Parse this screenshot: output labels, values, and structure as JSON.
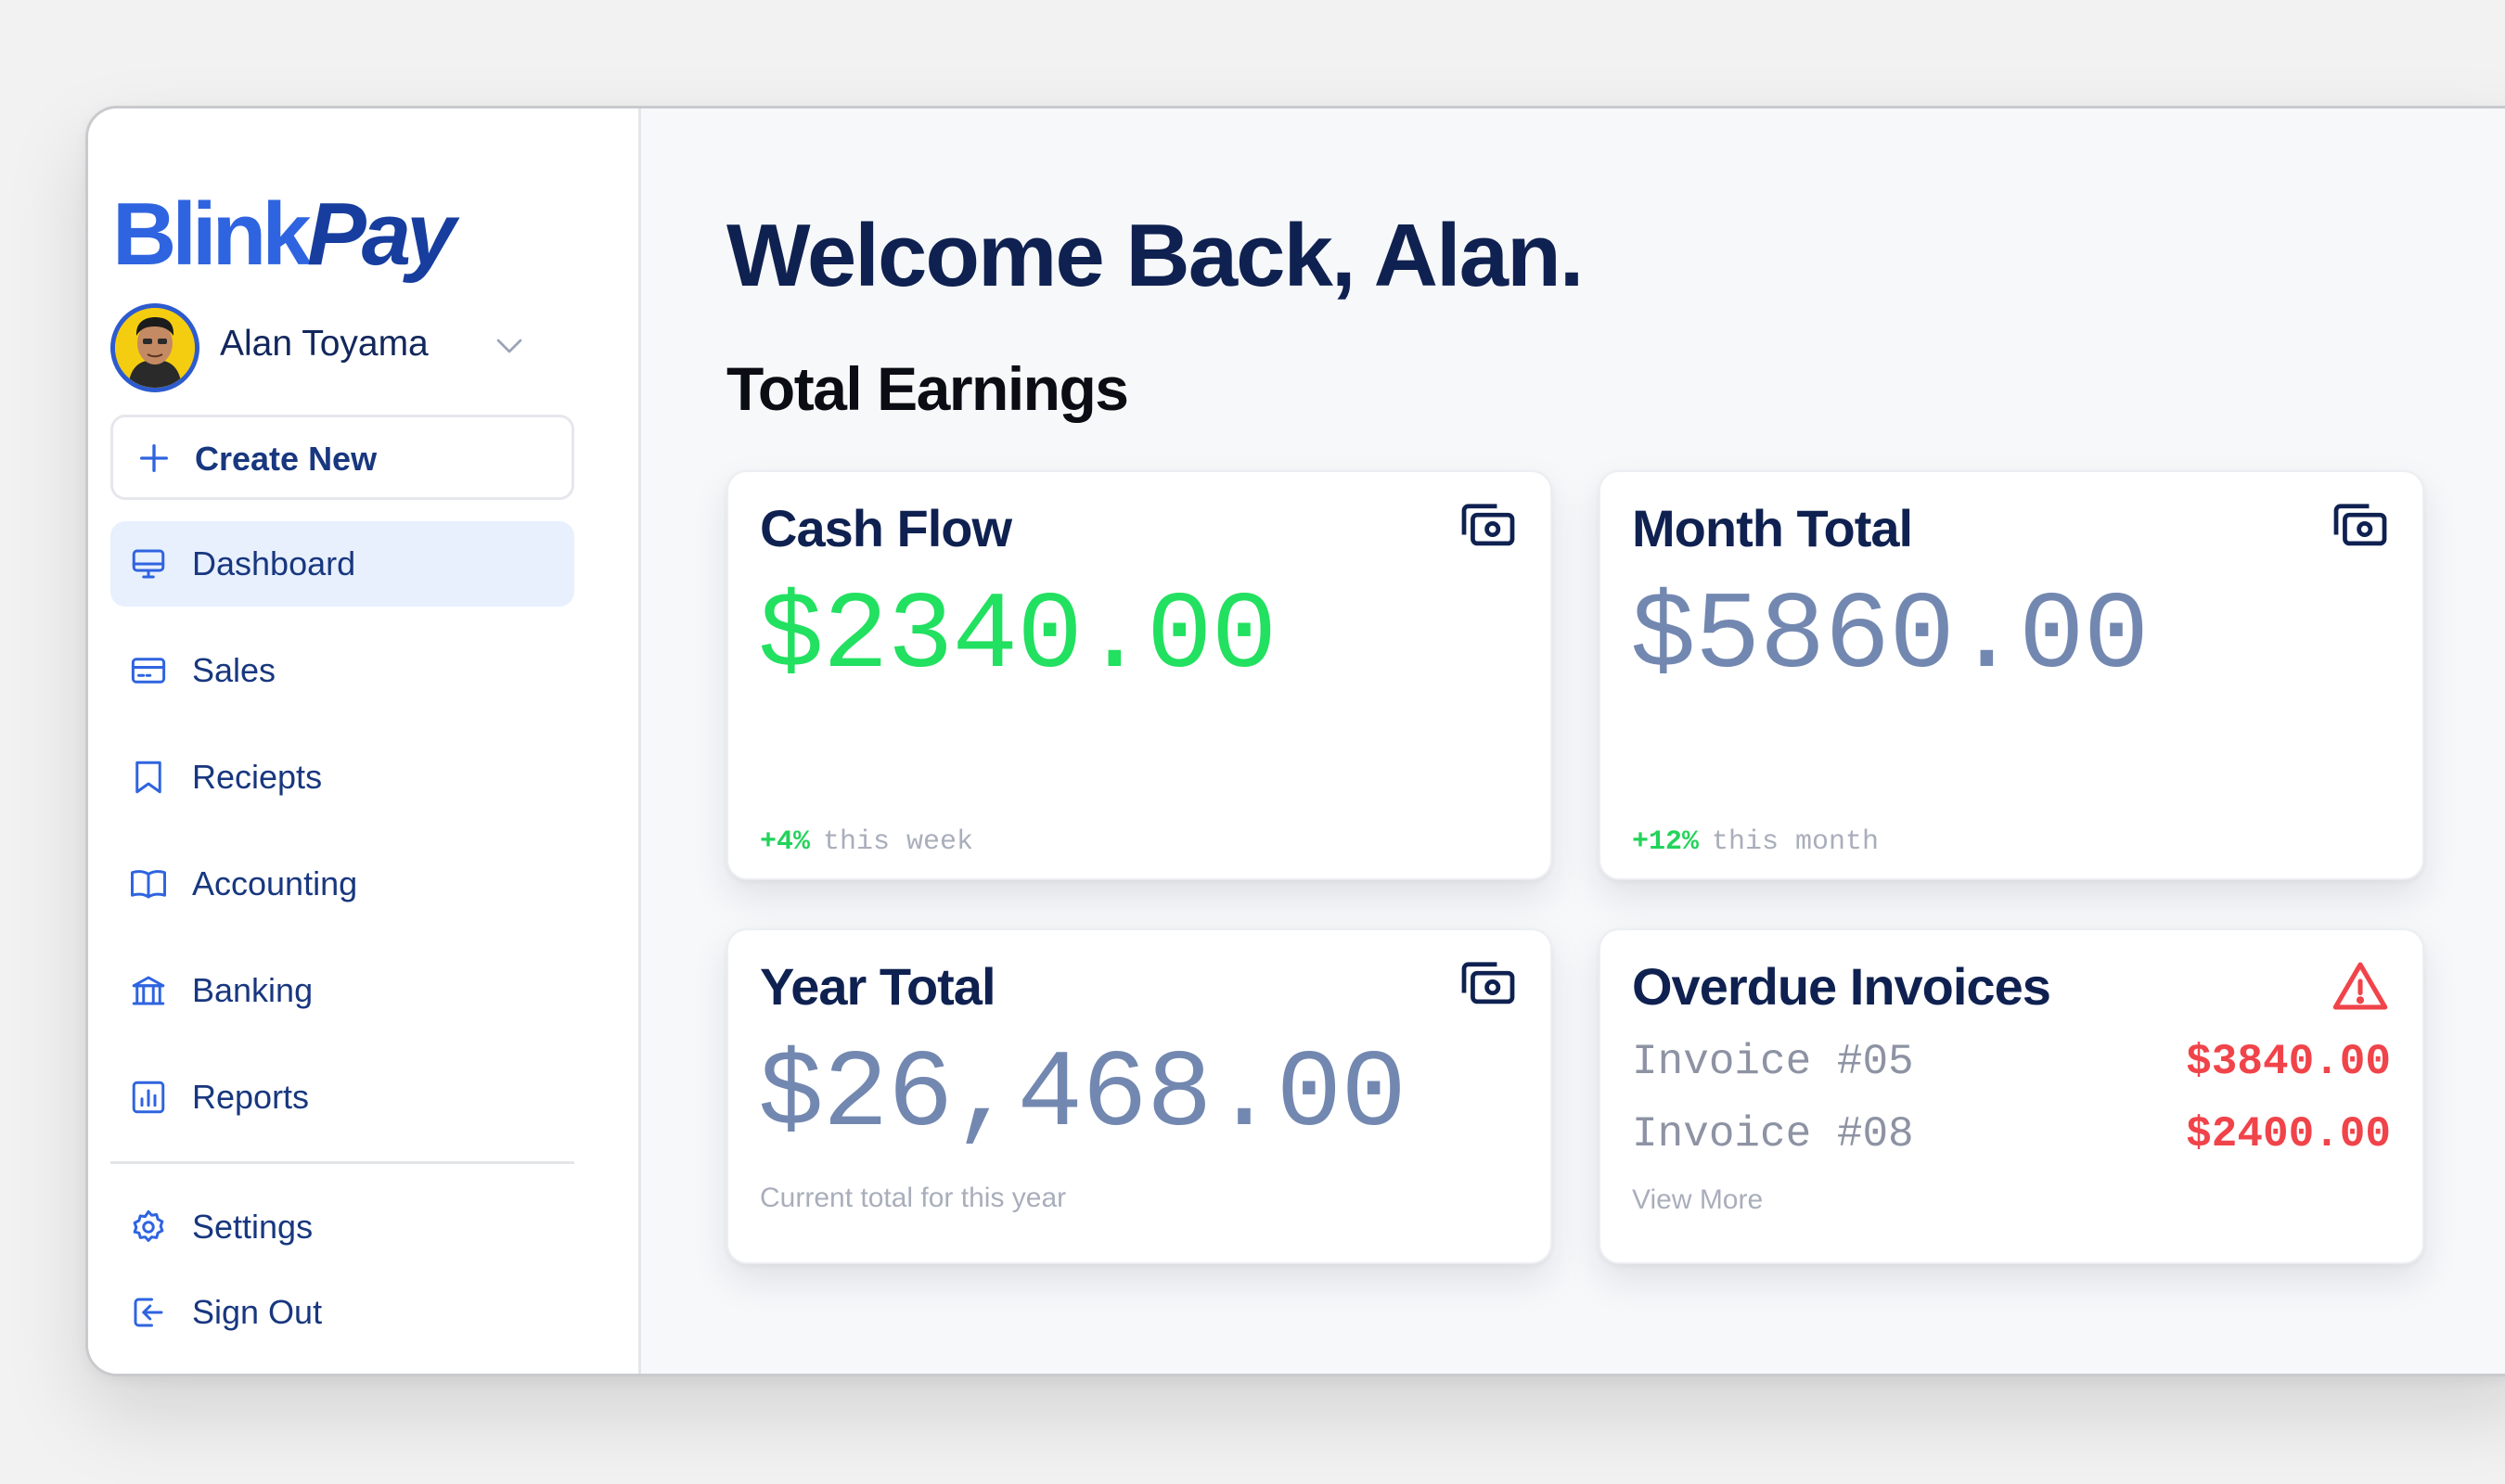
{
  "brand": {
    "part1": "Blink",
    "part2": "Pay",
    "color_primary": "#2f64e0",
    "color_dark": "#173e9e"
  },
  "user": {
    "name": "Alan Toyama"
  },
  "create_new": {
    "label": "Create New",
    "icon": "plus-icon"
  },
  "nav": {
    "items": [
      {
        "label": "Dashboard",
        "icon": "monitor-icon",
        "active": true
      },
      {
        "label": "Sales",
        "icon": "credit-card-icon"
      },
      {
        "label": "Reciepts",
        "icon": "bookmark-icon"
      },
      {
        "label": "Accounting",
        "icon": "book-open-icon"
      },
      {
        "label": "Banking",
        "icon": "bank-icon"
      },
      {
        "label": "Reports",
        "icon": "bar-chart-icon"
      }
    ],
    "bottom": [
      {
        "label": "Settings",
        "icon": "gear-icon"
      },
      {
        "label": "Sign Out",
        "icon": "sign-out-icon"
      }
    ]
  },
  "main": {
    "welcome": "Welcome Back, Alan.",
    "section_title": "Total Earnings",
    "cards": {
      "cash_flow": {
        "title": "Cash Flow",
        "amount": "$2340.00",
        "change": "+4%",
        "period": "this week",
        "icon": "cash-icon"
      },
      "month_total": {
        "title": "Month Total",
        "amount": "$5860.00",
        "change": "+12%",
        "period": "this month",
        "icon": "cash-icon"
      },
      "year_total": {
        "title": "Year Total",
        "amount": "$26,468.00",
        "note": "Current total for this year",
        "icon": "cash-icon"
      },
      "overdue": {
        "title": "Overdue Invoices",
        "icon": "warning-icon",
        "invoices": [
          {
            "label": "Invoice #05",
            "amount": "$3840.00"
          },
          {
            "label": "Invoice #08",
            "amount": "$2400.00"
          }
        ],
        "view_more": "View More"
      }
    }
  },
  "colors": {
    "accent_green": "#22e060",
    "alert_red": "#f0444a",
    "muted_slate": "#7388b0",
    "navy": "#0f2150"
  }
}
